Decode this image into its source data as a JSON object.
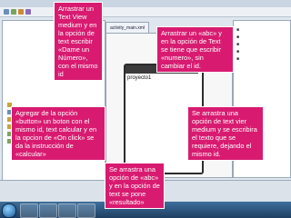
{
  "colors": {
    "callout_bg": "#d81b71",
    "callout_text": "#ffffff",
    "taskbar": "#2a5580"
  },
  "ide": {
    "editor_tab_label": "activity_main.xml",
    "phone_title": "proyecto1"
  },
  "callouts": {
    "top_left": "Arrastrar un Text View medium y en la opción de text escribir «Dame un Número», con el mismo id",
    "top_right": "Arrastrar un «abc» y en la opción de Text se tiene que escribir «numero», sin cambiar el id.",
    "mid_left": "Agregar de la opción «button» un boton con el mismo id, text calcular y en la opcion de «On click» se da la instrucción de «calcular»",
    "mid_right": "Se arrastra una opción de text vier medium y se escribira el texto que se requiere, dejando el mismo id.",
    "bottom_center": "Se arrastra una opción de «abc» y en la opción de text se pone «resultado»"
  },
  "taskbar": {
    "icons": [
      "start-orb-icon",
      "folder-icon",
      "media-icon",
      "browser-icon",
      "eclipse-icon"
    ]
  }
}
